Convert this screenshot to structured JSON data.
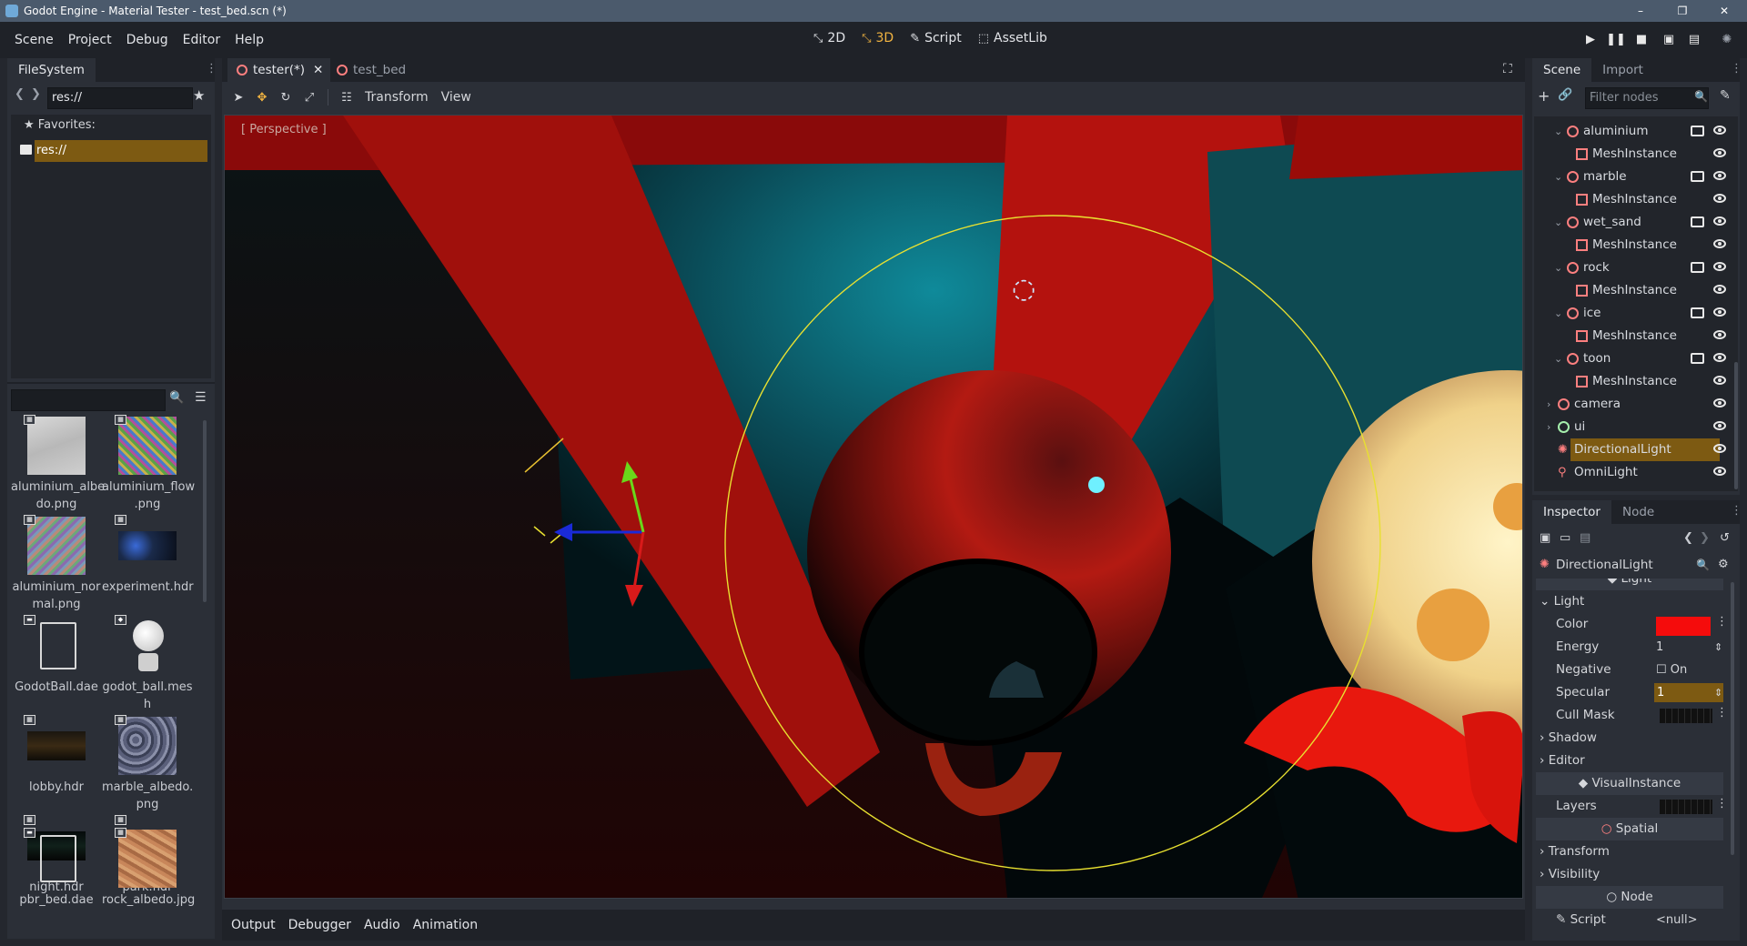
{
  "window": {
    "title": "Godot Engine - Material Tester - test_bed.scn (*)",
    "controls": [
      "–",
      "❐",
      "✕"
    ]
  },
  "menubar": {
    "menus": [
      "Scene",
      "Project",
      "Debug",
      "Editor",
      "Help"
    ],
    "modes": [
      {
        "label": "2D",
        "icon": "2d-icon"
      },
      {
        "label": "3D",
        "icon": "3d-icon"
      },
      {
        "label": "Script",
        "icon": "script-icon"
      },
      {
        "label": "AssetLib",
        "icon": "assetlib-icon"
      }
    ],
    "play_controls": [
      "play-icon",
      "pause-icon",
      "stop-icon",
      "play-scene-icon",
      "play-custom-icon",
      "loading-icon"
    ]
  },
  "filesystem": {
    "tab": "FileSystem",
    "path": "res://",
    "favorites_label": "Favorites:",
    "tree_root": "res://",
    "search_placeholder": "",
    "files": [
      {
        "name": "aluminium_albe\ndo.png",
        "l1": "aluminium_albe",
        "l2": "do.png"
      },
      {
        "name": "aluminium_flow.png",
        "l1": "aluminium_flow",
        "l2": ".png"
      },
      {
        "name": "aluminium_normal.png",
        "l1": "aluminium_nor",
        "l2": "mal.png"
      },
      {
        "name": "experiment.hdr",
        "l1": "experiment.hdr",
        "l2": ""
      },
      {
        "name": "GodotBall.dae",
        "l1": "GodotBall.dae",
        "l2": ""
      },
      {
        "name": "godot_ball.mesh",
        "l1": "godot_ball.mes",
        "l2": "h"
      },
      {
        "name": "lobby.hdr",
        "l1": "lobby.hdr",
        "l2": ""
      },
      {
        "name": "marble_albedo.png",
        "l1": "marble_albedo.",
        "l2": "png"
      },
      {
        "name": "night.hdr",
        "l1": "night.hdr",
        "l2": ""
      },
      {
        "name": "park.hdr",
        "l1": "park.hdr",
        "l2": ""
      },
      {
        "name": "pbr_bed.dae",
        "l1": "pbr_bed.dae",
        "l2": ""
      },
      {
        "name": "rock_albedo.jpg",
        "l1": "rock_albedo.jpg",
        "l2": ""
      }
    ]
  },
  "editor": {
    "tabs": [
      "tester(*)",
      "test_bed"
    ],
    "toolbar": {
      "transform": "Transform",
      "view": "View"
    },
    "viewport_label": "[ Perspective ]"
  },
  "bottom_panel": {
    "tabs": [
      "Output",
      "Debugger",
      "Audio",
      "Animation"
    ]
  },
  "scene_dock": {
    "tabs": [
      "Scene",
      "Import"
    ],
    "filter_placeholder": "Filter nodes",
    "nodes": [
      {
        "name": "aluminium",
        "kind": "spatial",
        "indent": 1,
        "expanded": true,
        "has_script_icon": true
      },
      {
        "name": "MeshInstance",
        "kind": "mesh",
        "indent": 2
      },
      {
        "name": "marble",
        "kind": "spatial",
        "indent": 1,
        "expanded": true,
        "has_script_icon": true
      },
      {
        "name": "MeshInstance",
        "kind": "mesh",
        "indent": 2
      },
      {
        "name": "wet_sand",
        "kind": "spatial",
        "indent": 1,
        "expanded": true,
        "has_script_icon": true
      },
      {
        "name": "MeshInstance",
        "kind": "mesh",
        "indent": 2
      },
      {
        "name": "rock",
        "kind": "spatial",
        "indent": 1,
        "expanded": true,
        "has_script_icon": true
      },
      {
        "name": "MeshInstance",
        "kind": "mesh",
        "indent": 2
      },
      {
        "name": "ice",
        "kind": "spatial",
        "indent": 1,
        "expanded": true,
        "has_script_icon": true
      },
      {
        "name": "MeshInstance",
        "kind": "mesh",
        "indent": 2
      },
      {
        "name": "toon",
        "kind": "spatial",
        "indent": 1,
        "expanded": true,
        "has_script_icon": true
      },
      {
        "name": "MeshInstance",
        "kind": "mesh",
        "indent": 2
      },
      {
        "name": "camera",
        "kind": "spatial",
        "indent": 0,
        "expanded": false
      },
      {
        "name": "ui",
        "kind": "control",
        "indent": 0,
        "expanded": false
      },
      {
        "name": "DirectionalLight",
        "kind": "light",
        "indent": 0,
        "selected": true
      },
      {
        "name": "OmniLight",
        "kind": "omni",
        "indent": 0
      }
    ]
  },
  "inspector": {
    "tabs": [
      "Inspector",
      "Node"
    ],
    "object": "DirectionalLight",
    "light_section_partial": "Light",
    "light_group": "Light",
    "properties": {
      "color_label": "Color",
      "color_value": "#f50c0c",
      "energy_label": "Energy",
      "energy_value": "1",
      "negative_label": "Negative",
      "negative_value": "On",
      "specular_label": "Specular",
      "specular_value": "1",
      "cullmask_label": "Cull Mask"
    },
    "groups": {
      "shadow": "Shadow",
      "editor": "Editor",
      "visualinstance": "VisualInstance",
      "layers": "Layers",
      "spatial": "Spatial",
      "transform": "Transform",
      "visibility": "Visibility",
      "node": "Node",
      "script_label": "Script",
      "script_value": "<null>"
    }
  },
  "colors": {
    "accent": "#f2b441",
    "selection": "#7d5a12",
    "node_icon": "#fc7f7f",
    "control_icon": "#a5efac",
    "titlebar": "#4b5a6c"
  }
}
